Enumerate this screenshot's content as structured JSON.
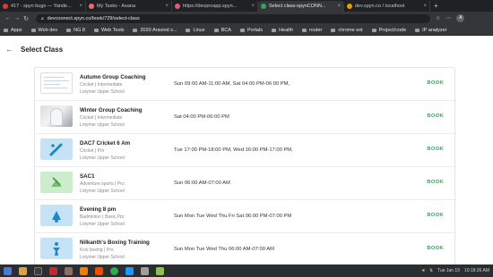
{
  "browser": {
    "tabs": [
      {
        "title": "417 - spyn bugs — Yande...",
        "color": "#d23f31"
      },
      {
        "title": "My Tasks - Asana",
        "color": "#f06a6a"
      },
      {
        "title": "https://devproapp.spyn...",
        "color": "#e05c7a"
      },
      {
        "title": "Select class-spynCONN...",
        "color": "#34a853"
      },
      {
        "title": "dev.spyn.co / localhost",
        "color": "#f29900"
      }
    ],
    "new_tab": "+",
    "url": "devconnect.spyn.co/book/729/select-class",
    "profile_initial": "A"
  },
  "bookmarks": [
    {
      "label": "Apps"
    },
    {
      "label": "Web dev"
    },
    {
      "label": "NG 8"
    },
    {
      "label": "Web Tools"
    },
    {
      "label": "2020 Aravind s..."
    },
    {
      "label": "Linux"
    },
    {
      "label": "BCA"
    },
    {
      "label": "Portals"
    },
    {
      "label": "Health"
    },
    {
      "label": "router"
    },
    {
      "label": "chrome ext"
    },
    {
      "label": "Project/code"
    },
    {
      "label": "IP analyzer"
    }
  ],
  "page": {
    "title": "Select Class",
    "book_label": "BOOK",
    "classes": [
      {
        "title": "Autumn Group Coaching",
        "sub": "Cricket | Intermediate",
        "school": "Lotymer Upper School",
        "schedule": "Sun 09:00 AM-11:00 AM, Sat 04:00 PM-06:00 PM,",
        "thumb": "document"
      },
      {
        "title": "Winter Group Coaching",
        "sub": "Cricket | Intermediate",
        "school": "Lotymer Upper School",
        "schedule": "Sat 04:00 PM-06:00 PM",
        "thumb": "photo"
      },
      {
        "title": "DAC7 Cricket 6 Am",
        "sub": "Cricket | Pro",
        "school": "Lotymer Upper School",
        "schedule": "Tue 17:00 PM-18:00 PM, Wed 16:00 PM-17:00 PM,",
        "thumb": "cricket-bat-icon"
      },
      {
        "title": "SAC1",
        "sub": "Adventure sports | Pro",
        "school": "Lotymer Upper School",
        "schedule": "Sun 06:00 AM-07:00 AM",
        "thumb": "adventure-icon"
      },
      {
        "title": "Evening 8 pm",
        "sub": "Badminton | Basic,Pro",
        "school": "Lotymer Upper School",
        "schedule": "Sun Mon Tue Wed Thu Fri Sat 06:00 PM-07:00 PM",
        "thumb": "shuttlecock-icon"
      },
      {
        "title": "Nilkanth's Boxing Training",
        "sub": "Kick boxing | Pro",
        "school": "Lotymer Upper School",
        "schedule": "Sun Mon Tue Wed Thu 06:00 AM-07:00 AM",
        "thumb": "boxing-icon"
      }
    ]
  },
  "taskbar": {
    "date": "Tue Jan 19",
    "time": "10:18:26 AM"
  }
}
